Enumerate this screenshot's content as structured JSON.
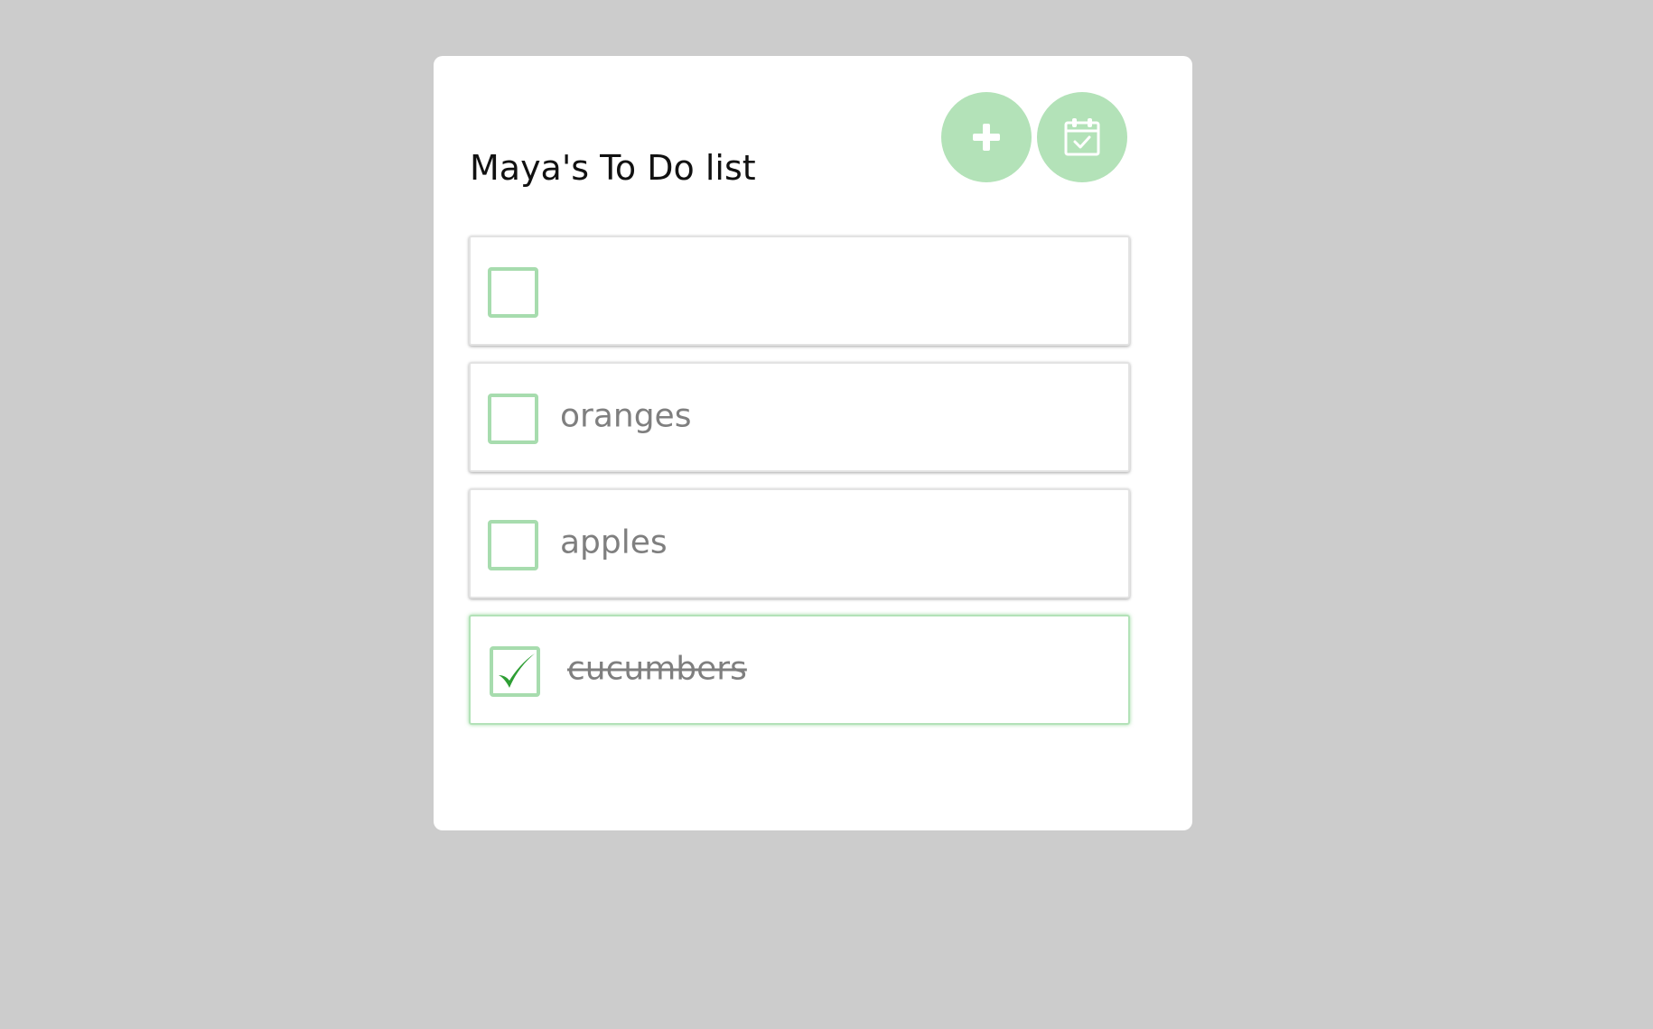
{
  "header": {
    "title": "Maya's To Do list",
    "add_icon": "plus-icon",
    "calendar_icon": "calendar-check-icon"
  },
  "todos": [
    {
      "text": "",
      "checked": false
    },
    {
      "text": "oranges",
      "checked": false
    },
    {
      "text": "apples",
      "checked": false
    },
    {
      "text": "cucumbers",
      "checked": true
    }
  ],
  "colors": {
    "background": "#cccccc",
    "card": "#ffffff",
    "accent": "#b3e2b8",
    "checkbox_border": "#a7dcae",
    "checkmark": "#2e9e34",
    "item_text": "#7f7f7f",
    "title_text": "#111111"
  }
}
